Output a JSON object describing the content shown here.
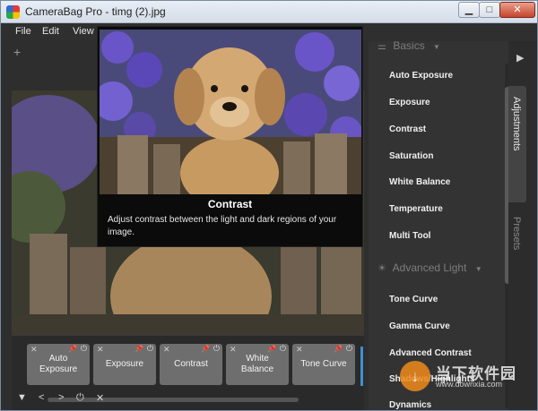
{
  "window": {
    "title": "CameraBag Pro - timg (2).jpg"
  },
  "menu": [
    "File",
    "Edit",
    "View"
  ],
  "left": {
    "add_label": "+"
  },
  "tooltip": {
    "title": "Contrast",
    "description": "Adjust contrast between the light and dark regions of your image."
  },
  "right_panel": {
    "sections": [
      {
        "name": "Basics",
        "icon": "sliders-icon",
        "items": [
          "Auto Exposure",
          "Exposure",
          "Contrast",
          "Saturation",
          "White Balance",
          "Temperature",
          "Multi Tool"
        ]
      },
      {
        "name": "Advanced Light",
        "icon": "sun-icon",
        "items": [
          "Tone Curve",
          "Gamma Curve",
          "Advanced Contrast",
          "Shadows/Highlights",
          "Dynamics"
        ]
      }
    ]
  },
  "tabs": [
    "Adjustments",
    "Presets"
  ],
  "preset_strip": {
    "tiles": [
      "Auto Exposure",
      "Exposure",
      "Contrast",
      "White Balance",
      "Tone Curve"
    ]
  },
  "watermark": {
    "name": "当下软件园",
    "url": "www.downxia.com"
  },
  "colors": {
    "accent": "#3d8fd6",
    "panel": "#333333",
    "tile": "#6e6e6e"
  }
}
